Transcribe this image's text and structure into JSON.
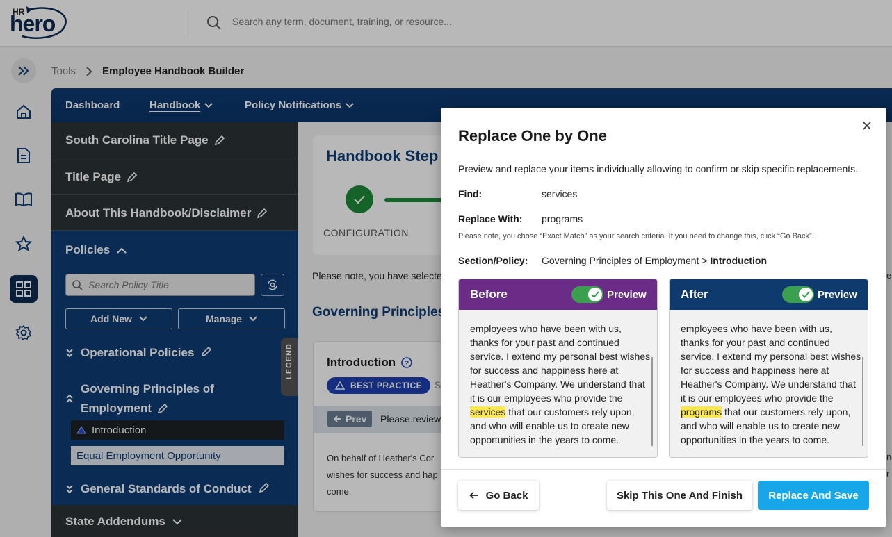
{
  "header": {
    "logo_hr": "HR",
    "logo_hero": "hero",
    "search_placeholder": "Search any term, document, training, or resource..."
  },
  "breadcrumb": {
    "root": "Tools",
    "current": "Employee Handbook Builder"
  },
  "nav": {
    "dashboard": "Dashboard",
    "handbook": "Handbook",
    "policy_notifications": "Policy Notifications"
  },
  "sidebar": {
    "rows": [
      "South Carolina Title Page",
      "Title Page",
      "About This Handbook/Disclaimer"
    ],
    "policies_title": "Policies",
    "search_placeholder": "Search Policy Title",
    "add_new": "Add New",
    "manage": "Manage",
    "cat_operational": "Operational Policies",
    "cat_governing_1": "Governing Principles of",
    "cat_governing_2": "Employment",
    "sub_intro": "Introduction",
    "sub_eeo": "Equal Employment Opportunity",
    "cat_general": "General Standards of Conduct",
    "state_addendums": "State Addendums",
    "legend": "LEGEND"
  },
  "content": {
    "steps_title": "Handbook Step",
    "step_label": "CONFIGURATION",
    "note": "Please note, you have selecte",
    "gov_title": "Governing Principles",
    "intro_title": "Introduction",
    "badge": "BEST PRACTICE",
    "badge_side": "S",
    "prev": "Prev",
    "review": "Please review",
    "intro_body": "On behalf of Heather's Cor wishes for success and hap come.",
    "peek_1": "ea",
    "peek_2": "nc",
    "peek_3": "r"
  },
  "modal": {
    "title": "Replace One by One",
    "description": "Preview and replace your items individually allowing to confirm or skip specific replacements.",
    "find_label": "Find:",
    "find_value": "services",
    "replace_label": "Replace With:",
    "replace_value": "programs",
    "note": "Please note, you chose “Exact Match” as your search criteria. If you need to change this, click “Go Back”.",
    "section_label": "Section/Policy:",
    "section_path": "Governing Principles of Employment > ",
    "section_leaf": "Introduction",
    "before": {
      "title": "Before",
      "preview": "Preview",
      "text_pre": "employees who have been with us, thanks for your past and continued service. I extend my personal best wishes for success and happiness here at Heather's Company. We understand that it is our employees who provide the ",
      "highlight": "services",
      "text_post": " that our customers rely upon, and who will enable us to create new opportunities in the years to come."
    },
    "after": {
      "title": "After",
      "preview": "Preview",
      "text_pre": "employees who have been with us, thanks for your past and continued service. I extend my personal best wishes for success and happiness here at Heather's Company. We understand that it is our employees who provide the ",
      "highlight": "programs",
      "text_post": " that our customers rely upon, and who will enable us to create new opportunities in the years to come."
    },
    "go_back": "Go Back",
    "skip": "Skip This One And Finish",
    "replace_save": "Replace And Save"
  },
  "colors": {
    "navy": "#0f3c75",
    "before_header": "#6b2c87",
    "after_header": "#0e3a6e",
    "toggle_on": "#3a9f4f",
    "highlight": "#ffe94a",
    "primary_button": "#17a6e8"
  }
}
